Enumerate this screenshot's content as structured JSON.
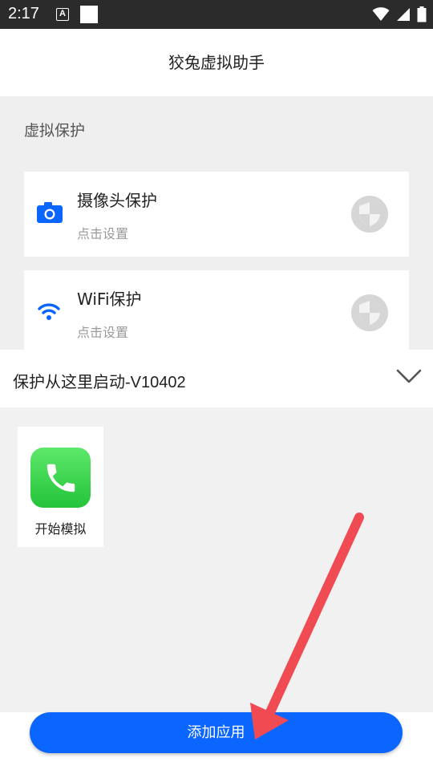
{
  "status_bar": {
    "time": "2:17",
    "badge_letter": "A",
    "icons": [
      "wifi-icon",
      "signal-icon",
      "battery-icon"
    ]
  },
  "app_bar": {
    "title": "狡兔虚拟助手"
  },
  "section": {
    "label": "虚拟保护"
  },
  "protections": [
    {
      "name": "摄像头保护",
      "sub": "点击设置",
      "icon": "camera-icon"
    },
    {
      "name": "WiFi保护",
      "sub": "点击设置",
      "icon": "wifi-icon"
    }
  ],
  "launch": {
    "label": "保护从这里启动-V10402",
    "icon": "chevron-down-icon"
  },
  "apps": [
    {
      "name": "开始模拟",
      "icon": "phone-icon"
    }
  ],
  "bottom": {
    "add_button": "添加应用"
  },
  "colors": {
    "accent": "#0a66ff",
    "status_bar": "#2b2b2b",
    "annotation_arrow": "#f04a52",
    "phone_green": "#2ac940"
  }
}
